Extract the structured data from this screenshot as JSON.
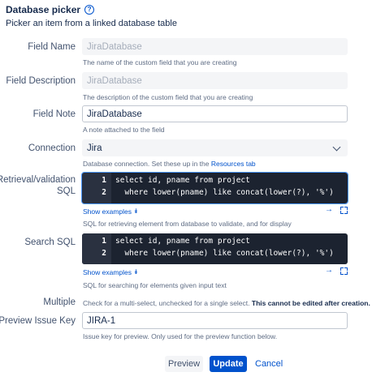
{
  "header": {
    "title": "Database picker",
    "subtitle": "Picker an item from a linked database table"
  },
  "fields": {
    "field_name": {
      "label": "Field Name",
      "value": "JiraDatabase",
      "description": "The name of the custom field that you are creating"
    },
    "field_description": {
      "label": "Field Description",
      "value": "JiraDatabase",
      "description": "The description of the custom field that you are creating"
    },
    "field_note": {
      "label": "Field Note",
      "value": "JiraDatabase",
      "description": "A note attached to the field"
    },
    "connection": {
      "label": "Connection",
      "value": "Jira",
      "description_prefix": "Database connection. Set these up in the ",
      "description_link": "Resources tab"
    },
    "retrieval_sql": {
      "label_line1": "Retrieval/validation",
      "label_line2": "SQL",
      "lines": [
        {
          "number": "1",
          "code": "select id, pname from project"
        },
        {
          "number": "2",
          "code": "  where lower(pname) like concat(lower(?), '%')"
        }
      ],
      "examples_link": "Show examples",
      "description": "SQL for retrieving element from database to validate, and for display"
    },
    "search_sql": {
      "label": "Search SQL",
      "lines": [
        {
          "number": "1",
          "code": "select id, pname from project"
        },
        {
          "number": "2",
          "code": "  where lower(pname) like concat(lower(?), '%')"
        }
      ],
      "examples_link": "Show examples",
      "description": "SQL for searching for elements given input text"
    },
    "multiple": {
      "label": "Multiple",
      "description_prefix": "Check for a multi-select, unchecked for a single select. ",
      "description_bold": "This cannot be edited after creation."
    },
    "preview_issue_key": {
      "label": "Preview Issue Key",
      "value": "JIRA-1",
      "description": "Issue key for preview. Only used for the preview function below."
    }
  },
  "buttons": {
    "preview": "Preview",
    "update": "Update",
    "cancel": "Cancel"
  },
  "colors": {
    "primary": "#0052cc",
    "code_bg": "#1c2330",
    "text": "#172b4d",
    "subtle_text": "#5e6c84"
  }
}
